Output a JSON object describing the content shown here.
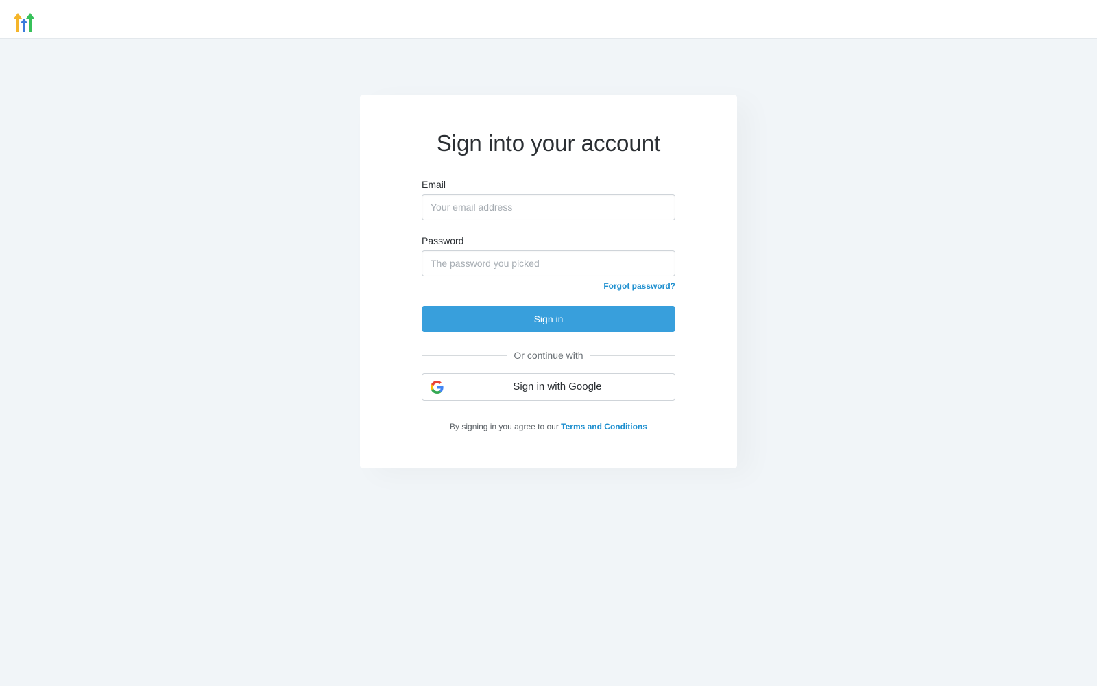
{
  "header": {
    "logo_icon": "gohighlevel-arrows-logo"
  },
  "signin": {
    "title": "Sign into your account",
    "email_label": "Email",
    "email_placeholder": "Your email address",
    "email_value": "",
    "password_label": "Password",
    "password_placeholder": "The password you picked",
    "password_value": "",
    "forgot_password": "Forgot password?",
    "submit_label": "Sign in",
    "divider_text": "Or continue with",
    "google_label": "Sign in with Google",
    "google_icon": "google-g-icon",
    "terms_prefix": "By signing in you agree to our",
    "terms_link": "Terms and Conditions"
  },
  "colors": {
    "primary": "#389fdc",
    "link": "#1e8fcf",
    "background": "#f1f5f8"
  }
}
